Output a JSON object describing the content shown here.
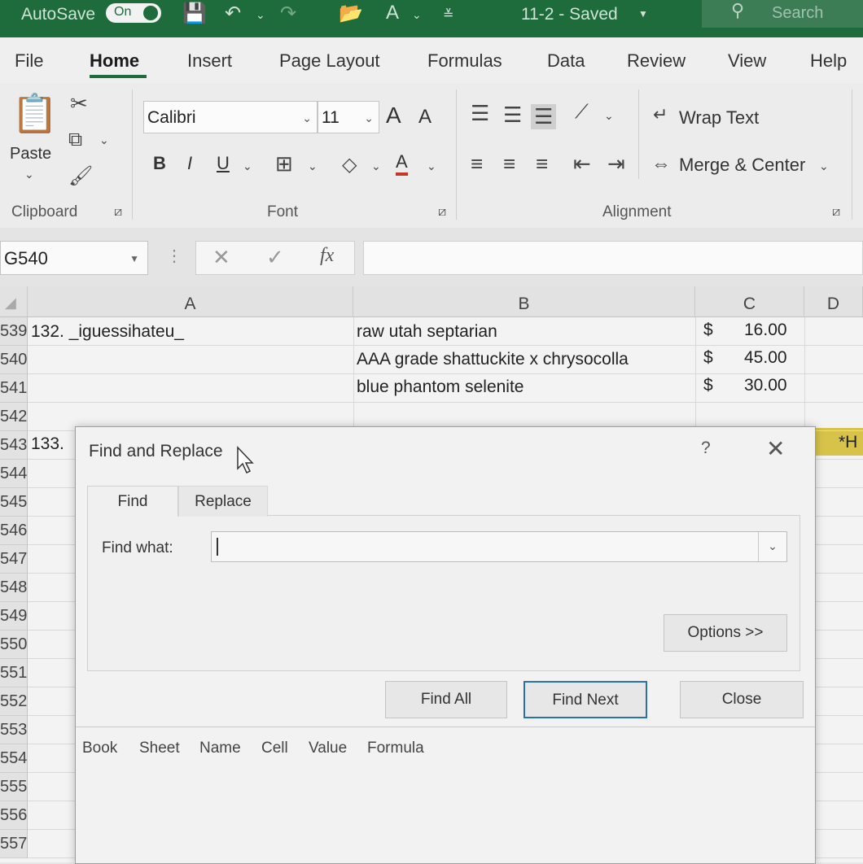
{
  "titlebar": {
    "autosave_label": "AutoSave",
    "autosave_state": "On",
    "doc_title": "11-2 - Saved",
    "search_placeholder": "Search"
  },
  "ribbon_tabs": [
    "File",
    "Home",
    "Insert",
    "Page Layout",
    "Formulas",
    "Data",
    "Review",
    "View",
    "Help"
  ],
  "ribbon": {
    "clipboard": {
      "paste_label": "Paste",
      "group_label": "Clipboard"
    },
    "font": {
      "font_name": "Calibri",
      "font_size": "11",
      "group_label": "Font",
      "bold": "B",
      "italic": "I",
      "underline": "U",
      "grow": "A",
      "shrink": "A",
      "color_a": "A"
    },
    "alignment": {
      "wrap_text": "Wrap Text",
      "merge_center": "Merge & Center",
      "group_label": "Alignment"
    }
  },
  "formula_bar": {
    "name_box": "G540",
    "fx": "fx",
    "cancel": "✕",
    "enter": "✓"
  },
  "grid": {
    "columns": [
      "A",
      "B",
      "C",
      "D"
    ],
    "rows": [
      "539",
      "540",
      "541",
      "542",
      "543",
      "544",
      "545",
      "546",
      "547",
      "548",
      "549",
      "550",
      "551",
      "552",
      "553",
      "554",
      "555",
      "556",
      "557"
    ],
    "cells": {
      "r539_a": "132. _iguessihateu_",
      "r539_b": "raw utah septarian",
      "r539_c_cur": "$",
      "r539_c": "16.00",
      "r540_b": "AAA grade shattuckite x chrysocolla",
      "r540_c_cur": "$",
      "r540_c": "45.00",
      "r541_b": "blue phantom selenite",
      "r541_c_cur": "$",
      "r541_c": "30.00",
      "r543_a": "133.",
      "r543_d": "*H"
    }
  },
  "dialog": {
    "title": "Find and Replace",
    "help": "?",
    "close": "✕",
    "tabs": [
      "Find",
      "Replace"
    ],
    "find_what_label": "Find what:",
    "find_what_value": "",
    "options_button": "Options >>",
    "find_all_button": "Find All",
    "find_next_button": "Find Next",
    "close_button": "Close",
    "results_headers": [
      "Book",
      "Sheet",
      "Name",
      "Cell",
      "Value",
      "Formula"
    ]
  },
  "colors": {
    "accent_green": "#1e6b3c",
    "highlight_yellow": "#d8c34a",
    "focus_blue": "#2b6fb3"
  }
}
